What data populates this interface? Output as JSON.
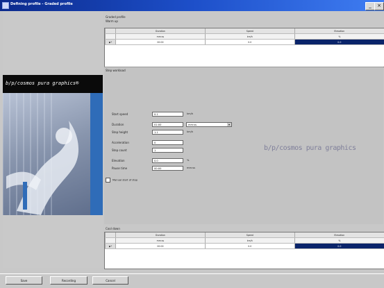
{
  "window": {
    "title": "Defining profile - Graded profile",
    "controls": [
      "_",
      "×"
    ]
  },
  "brand": {
    "banner_text": "b/p/cosmos pura graphics®",
    "watermark": "b/p/cosmos pura graphics"
  },
  "profile_label": "Graded profile",
  "warmup": {
    "label": "Warm up",
    "headers": [
      "Duration",
      "Speed",
      "Elevation"
    ],
    "units": [
      "mm:ss",
      "km/h",
      "%"
    ],
    "rows": [
      [
        "00:00",
        "0.0",
        "0.0"
      ]
    ]
  },
  "step_workload": {
    "label": "Step workload",
    "fields": [
      {
        "label": "Start speed",
        "value": "0.1",
        "unit": "km/h"
      },
      {
        "label": "Duration",
        "value": "01:00",
        "unit": ""
      },
      {
        "label": "Step height",
        "value": "1.1",
        "unit": "km/h"
      },
      {
        "label": "Acceleration",
        "value": "0",
        "unit": ""
      },
      {
        "label": "Step count",
        "value": "1",
        "unit": ""
      },
      {
        "label": "Elevation",
        "value": "0.0",
        "unit": "%"
      },
      {
        "label": "Pause time",
        "value": "00:00",
        "unit": "mm:ss"
      }
    ],
    "duration_dropdown": "mm:ss",
    "checkbox_label": "Manual start of step"
  },
  "cool_down": {
    "label": "Cool down",
    "headers": [
      "Duration",
      "Speed",
      "Elevation"
    ],
    "units": [
      "mm:ss",
      "km/h",
      "%"
    ],
    "rows": [
      [
        "00:00",
        "0.0",
        "0.0"
      ]
    ]
  },
  "buttons": {
    "save": "Save",
    "recording": "Recording",
    "cancel": "Cancel"
  },
  "colors": {
    "titlebar": "#0b2a8c",
    "selection": "#0a246a",
    "accent_bar": "#2f6cb8"
  }
}
